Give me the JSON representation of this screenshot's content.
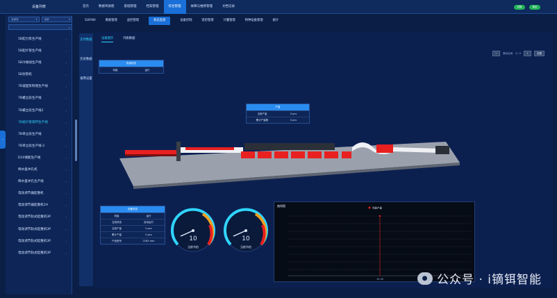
{
  "app": {
    "brand": "设备列表"
  },
  "topnav": {
    "items": [
      "首页",
      "数据驾驶舱",
      "基础管理",
      "档案管理",
      "综合管理",
      "故障与维修管理",
      "文档记录"
    ],
    "active_index": 4,
    "badges": [
      "切换",
      "退出"
    ],
    "badge_color": "#21b35a"
  },
  "sidebar": {
    "select1": "全部线",
    "select2": "全部",
    "search_placeholder": "",
    "lines": [
      "5B起力泵生产线",
      "5B起片管生产线",
      "5B冷端线生产线",
      "5B封管机",
      "7B凝固泵制液生产线",
      "7B螺立段生产线",
      "7B螺立段生产线2",
      "7B组片管液环生产线",
      "7B单立段生产线",
      "7B单立段生产线-2",
      "D10储能生产线",
      "稀水盘冲孔机",
      "稀水盘冲孔生产线",
      "电动调节器起重机",
      "电动调节器起重机2H",
      "电动调节轨式起重机3P",
      "电动调节轨式起重机3P",
      "电动调节轨式起重机3P",
      "电动调节轨式起重机3P"
    ],
    "active_index": 7,
    "pull_label": "›"
  },
  "subnav": {
    "items": [
      "SOP/WI",
      "看板管理",
      "品控管理",
      "状态监测",
      "设备控制",
      "巡检管理",
      "计量管理",
      "特种设备管理",
      "统计"
    ],
    "active_index": 3
  },
  "vtabs": [
    "实时数据",
    "历史数据",
    "报警设置"
  ],
  "vtab_active": 0,
  "main": {
    "tabs": [
      "设备图示",
      "列表数据"
    ],
    "active_tab": 0,
    "controls": {
      "btn1": "一",
      "label": "报价区间",
      "value": "0 / 0",
      "btn2": "+",
      "btn3": "设置"
    },
    "card_status": {
      "head": "机组状态",
      "k": "机组",
      "v": "运行"
    },
    "card_output": {
      "head": "产量",
      "rows": [
        [
          "当班产量",
          "0 pcs"
        ],
        [
          "累计产量数",
          "0 pcs"
        ]
      ]
    },
    "card_device": {
      "head": "设备状态",
      "rows": [
        [
          "机组",
          "运行"
        ],
        [
          "当班状态",
          "自动运行"
        ],
        [
          "当班产量",
          "0 pcs"
        ],
        [
          "累计产量",
          "0 pcs"
        ],
        [
          "产品型号",
          "2185 mm"
        ]
      ]
    },
    "gauges": [
      {
        "value": "10",
        "caption": "当前节拍",
        "level": 0.15
      },
      {
        "value": "10",
        "caption": "当前节拍",
        "level": 0.15
      }
    ],
    "trend": {
      "title": "曲线图",
      "legend": "当前产量",
      "x_label": "15:45"
    }
  },
  "watermark": "公众号 · i镝铒智能",
  "colors": {
    "accent": "#1a6fd8",
    "highlight": "#2fd5ff",
    "machine_red": "#e82020"
  }
}
